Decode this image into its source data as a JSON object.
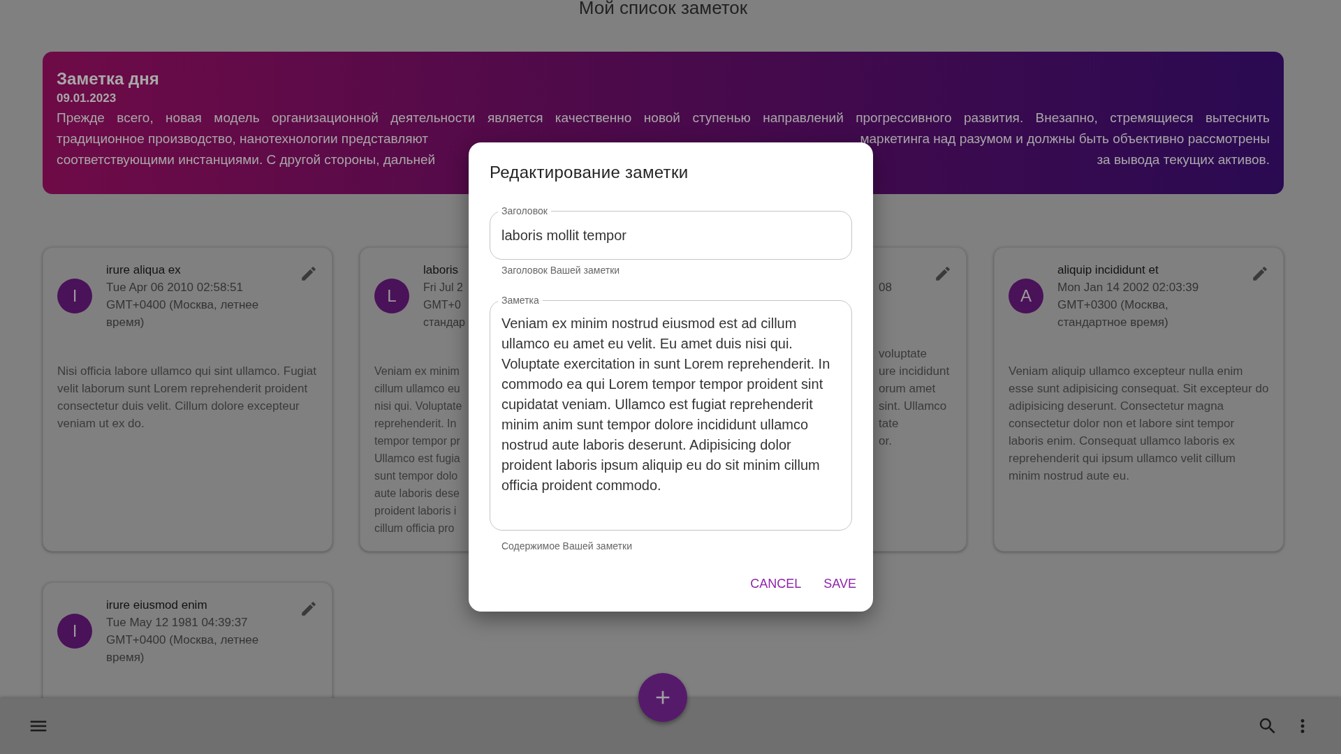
{
  "page_title": "Мой список заметок",
  "note_of_day": {
    "title": "Заметка дня",
    "date": "09.01.2023",
    "lines": [
      {
        "parts": [
          "Прежде всего, новая модель организационной деятельности является качественно новой ступенью направлений прогрессивного развития. Внезапно, стремящиеся вытеснить"
        ]
      },
      {
        "parts": [
          "традиционное производство, нанотехнологии представляют",
          "маркетинга над разумом и должны быть объективно рассмотрены"
        ]
      },
      {
        "parts": [
          "соответствующими инстанциями. С другой стороны, дальней",
          "за вывода текущих активов."
        ]
      }
    ]
  },
  "notes": [
    {
      "kind": "full",
      "avatar": "I",
      "title": "irure aliqua ex",
      "date": "Tue Apr 06 2010 02:58:51 GMT+0400 (Москва, летнее время)",
      "body": "Nisi officia labore ullamco qui sint ullamco. Fugiat velit laborum sunt Lorem reprehenderit proident consectetur duis velit. Cillum dolore excepteur veniam ut ex do."
    },
    {
      "kind": "clipped_left",
      "avatar": "L",
      "title": "laboris",
      "date_lines": [
        "Fri Jul 2",
        "GMT+0",
        "стандар"
      ],
      "body_lines": [
        "Veniam ex minim",
        "cillum ullamco eu",
        "nisi qui. Voluptate",
        "reprehenderit. In",
        "tempor tempor pr",
        "Ullamco est fugia",
        "sunt tempor dolo",
        "aute laboris dese",
        "proident laboris i",
        "cillum officia pro"
      ]
    },
    {
      "kind": "clipped_right",
      "date_lines": [
        "08"
      ],
      "body_lines": [
        "voluptate",
        "ure incididunt",
        "orum amet",
        "sint. Ullamco",
        "tate",
        "or."
      ]
    },
    {
      "kind": "full",
      "avatar": "A",
      "title": "aliquip incididunt et",
      "date": "Mon Jan 14 2002 02:03:39 GMT+0300 (Москва, стандартное время)",
      "body": "Veniam aliquip ullamco excepteur nulla enim esse sunt adipisicing consequat. Sit excepteur do adipisicing deserunt. Consectetur magna consectetur dolor non et labore sint tempor laboris enim. Consequat ullamco laboris ex reprehenderit qui ipsum ullamco velit cillum minim nostrud aute eu."
    },
    {
      "kind": "full",
      "avatar": "I",
      "title": "irure eiusmod enim",
      "date": "Tue May 12 1981 04:39:37 GMT+0400 (Москва, летнее время)"
    }
  ],
  "dialog": {
    "title": "Редактирование заметки",
    "fields": [
      {
        "kind": "text",
        "label": "Заголовок",
        "value": "laboris mollit tempor",
        "helper": "Заголовок Вашей заметки"
      },
      {
        "kind": "multiline",
        "label": "Заметка",
        "value": "Veniam ex minim nostrud eiusmod est ad cillum ullamco eu amet eu velit. Eu amet duis nisi qui. Voluptate exercitation in sunt Lorem reprehenderit. In commodo ea qui Lorem tempor tempor proident sint cupidatat veniam. Ullamco est fugiat reprehenderit minim anim sunt tempor dolore incididunt ullamco nostrud aute laboris deserunt. Adipisicing dolor proident laboris ipsum aliquip eu do sit minim cillum officia proident commodo.",
        "helper": "Содержимое Вашей заметки"
      }
    ],
    "buttons": [
      "CANCEL",
      "SAVE"
    ]
  }
}
